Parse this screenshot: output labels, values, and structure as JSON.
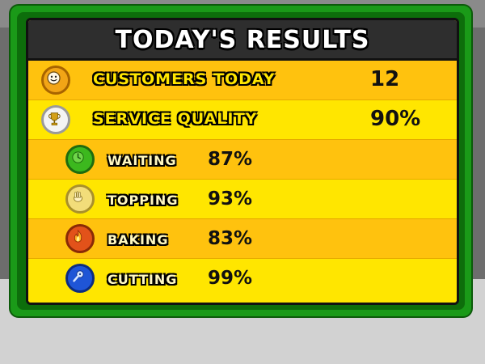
{
  "header": {
    "title": "TODAY'S RESULTS"
  },
  "summary": [
    {
      "label": "CUSTOMERS TODAY",
      "value": "12",
      "icon": "smiley-face-icon"
    },
    {
      "label": "SERVICE QUALITY",
      "value": "90%",
      "icon": "trophy-icon"
    }
  ],
  "stations": [
    {
      "label": "WAITING",
      "value": "87%",
      "icon": "clock-icon",
      "color": "#3cb81e"
    },
    {
      "label": "TOPPING",
      "value": "93%",
      "icon": "hand-icon",
      "color": "#f2dd7a"
    },
    {
      "label": "BAKING",
      "value": "83%",
      "icon": "flame-icon",
      "color": "#e2521a"
    },
    {
      "label": "CUTTING",
      "value": "99%",
      "icon": "pizza-cutter-icon",
      "color": "#1f55d6"
    }
  ],
  "colors": {
    "frame": "#1a9a18",
    "board_dark": "#ffc20e",
    "board_light": "#ffe600",
    "header": "#2e2e2e"
  }
}
